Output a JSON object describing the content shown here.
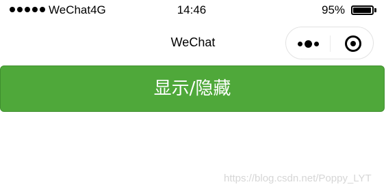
{
  "status_bar": {
    "carrier": "WeChat4G",
    "time": "14:46",
    "battery_percent": "95%",
    "battery_level": 0.95
  },
  "nav_bar": {
    "title": "WeChat",
    "menu_icon": "more-dots-icon",
    "close_icon": "target-circle-icon"
  },
  "main": {
    "toggle_button_label": "显示/隐藏",
    "button_color": "#4fa83a"
  },
  "watermark": "https://blog.csdn.net/Poppy_LYT"
}
